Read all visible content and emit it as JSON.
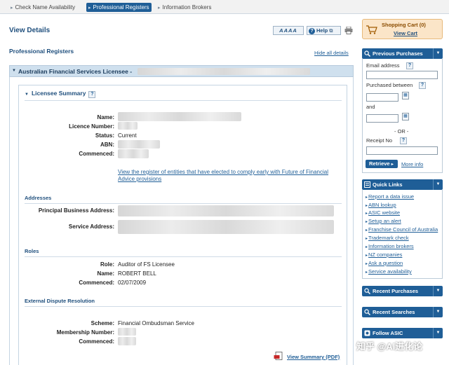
{
  "top_tabs": [
    {
      "label": "Check Name Availability",
      "active": false
    },
    {
      "label": "Professional Registers",
      "active": true
    },
    {
      "label": "Information Brokers",
      "active": false
    }
  ],
  "header": {
    "title": "View Details",
    "font_sizes_label": "AAAA",
    "help_label": "Help"
  },
  "main": {
    "subtitle": "Professional Registers",
    "hide_all": "Hide all details",
    "panel_title": "Australian Financial Services Licensee -",
    "summary": {
      "heading": "Licensee Summary",
      "fields": [
        {
          "label": "Name:",
          "value": ""
        },
        {
          "label": "Licence Number:",
          "value": ""
        },
        {
          "label": "Status:",
          "value": "Current"
        },
        {
          "label": "ABN:",
          "value": ""
        },
        {
          "label": "Commenced:",
          "value": ""
        }
      ],
      "early_link": "View the register of entities that have elected to comply early with Future of Financial Advice provisions"
    },
    "addresses": {
      "heading": "Addresses",
      "principal_label": "Principal Business Address:",
      "service_label": "Service Address:"
    },
    "roles": {
      "heading": "Roles",
      "fields": [
        {
          "label": "Role:",
          "value": "Auditor of FS Licensee"
        },
        {
          "label": "Name:",
          "value": "ROBERT BELL"
        },
        {
          "label": "Commenced:",
          "value": "02/07/2009"
        }
      ]
    },
    "edr": {
      "heading": "External Dispute Resolution",
      "fields": [
        {
          "label": "Scheme:",
          "value": "Financial Ombudsman Service"
        },
        {
          "label": "Membership Number:",
          "value": ""
        },
        {
          "label": "Commenced:",
          "value": ""
        }
      ]
    },
    "view_summary": "View Summary (PDF)"
  },
  "sidebar": {
    "cart_title": "Shopping Cart (0)",
    "cart_link": "View Cart",
    "previous_purchases": {
      "title": "Previous Purchases",
      "email_label": "Email address",
      "purchased_between": "Purchased between",
      "and_label": "and",
      "or_label": "- OR -",
      "receipt_label": "Receipt No",
      "retrieve_label": "Retrieve",
      "more_info": "More info"
    },
    "quick_links": {
      "title": "Quick Links",
      "items": [
        "Report a data issue",
        "ABN lookup",
        "ASIC website",
        "Setup an alert",
        "Franchise Council of Australia",
        "Trademark check",
        "Information brokers",
        "NZ companies",
        "Ask a question",
        "Service availability"
      ]
    },
    "recent_purchases": "Recent Purchases",
    "recent_searches": "Recent Searches",
    "follow_asic": "Follow ASIC"
  },
  "watermark": "知乎 @AI进化论",
  "colors": {
    "accent": "#1f5e97",
    "panel_header": "#cfe0ee",
    "cart_bg": "#fbe5c8"
  }
}
